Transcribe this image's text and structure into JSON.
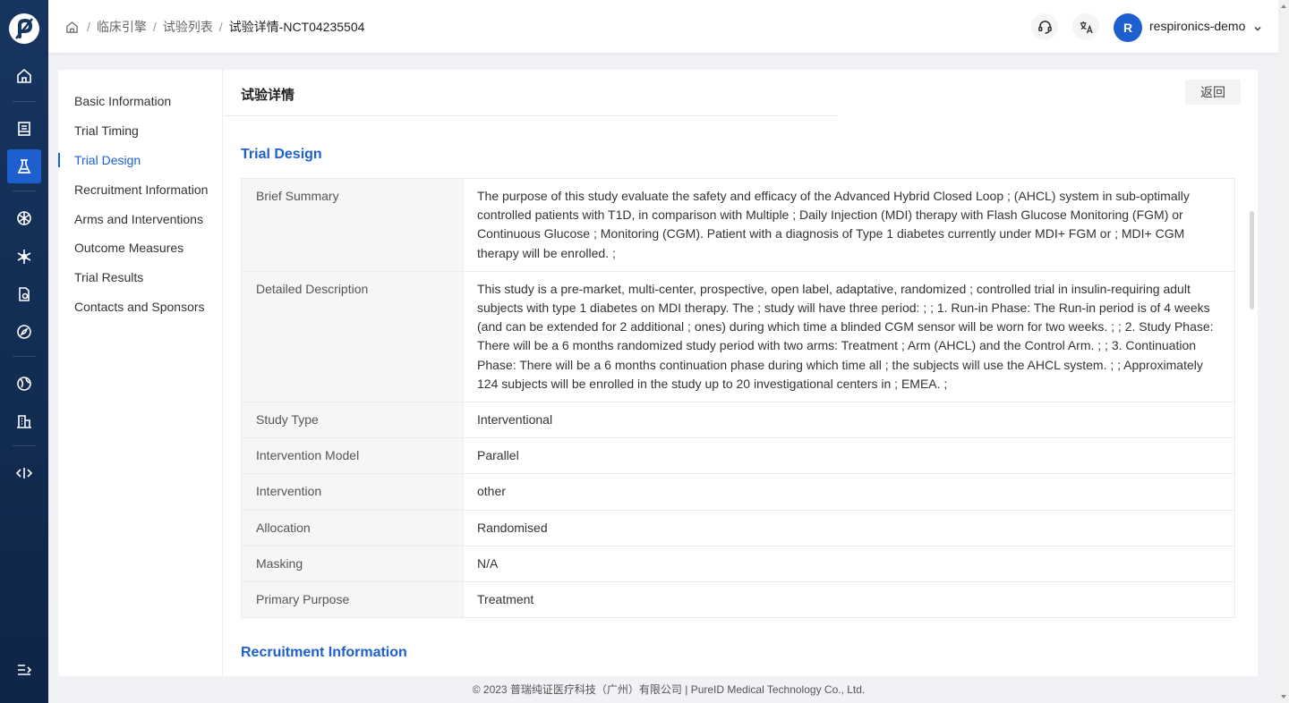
{
  "rail": {
    "icons": [
      "logo-icon",
      "home-icon",
      "document-icon",
      "flask-icon",
      "cube-icon",
      "snowflake-icon",
      "file-check-icon",
      "compass-icon",
      "globe-icon",
      "building-icon",
      "code-icon",
      "menu-expand-icon"
    ]
  },
  "breadcrumb": {
    "items": [
      "临床引擎",
      "试验列表",
      "试验详情-NCT04235504"
    ]
  },
  "header": {
    "avatar_letter": "R",
    "username": "respironics-demo"
  },
  "sidenav": {
    "items": [
      "Basic Information",
      "Trial Timing",
      "Trial Design",
      "Recruitment Information",
      "Arms and Interventions",
      "Outcome Measures",
      "Trial Results",
      "Contacts and Sponsors"
    ],
    "active_index": 2
  },
  "content": {
    "title": "试验详情",
    "back_label": "返回",
    "section_trial_design": "Trial Design",
    "section_recruitment": "Recruitment Information"
  },
  "trial_design": {
    "rows": [
      {
        "label": "Brief Summary",
        "value": "The purpose of this study evaluate the safety and efficacy of the Advanced Hybrid Closed Loop ; (AHCL) system in sub-optimally controlled patients with T1D, in comparison with Multiple ; Daily Injection (MDI) therapy with Flash Glucose Monitoring (FGM) or Continuous Glucose ; Monitoring (CGM). Patient with a diagnosis of Type 1 diabetes currently under MDI+ FGM or ; MDI+ CGM therapy will be enrolled. ;"
      },
      {
        "label": "Detailed Description",
        "value": "This study is a pre-market, multi-center, prospective, open label, adaptative, randomized ; controlled trial in insulin-requiring adult subjects with type 1 diabetes on MDI therapy. The ; study will have three period: ; ; 1. Run-in Phase: The Run-in period is of 4 weeks (and can be extended for 2 additional ; ones) during which time a blinded CGM sensor will be worn for two weeks. ; ; 2. Study Phase: There will be a 6 months randomized study period with two arms: Treatment ; Arm (AHCL) and the Control Arm. ; ; 3. Continuation Phase: There will be a 6 months continuation phase during which time all ; the subjects will use the AHCL system. ; ; Approximately 124 subjects will be enrolled in the study up to 20 investigational centers in ; EMEA. ;"
      },
      {
        "label": "Study Type",
        "value": "Interventional"
      },
      {
        "label": "Intervention Model",
        "value": "Parallel"
      },
      {
        "label": "Intervention",
        "value": "other"
      },
      {
        "label": "Allocation",
        "value": "Randomised"
      },
      {
        "label": "Masking",
        "value": "N/A"
      },
      {
        "label": "Primary Purpose",
        "value": "Treatment"
      }
    ]
  },
  "footer": {
    "text": "© 2023 普瑞纯证医疗科技（广州）有限公司 | PureID Medical Technology Co., Ltd."
  },
  "colors": {
    "accent": "#1e5fd0",
    "rail_bg": "#16355f"
  }
}
